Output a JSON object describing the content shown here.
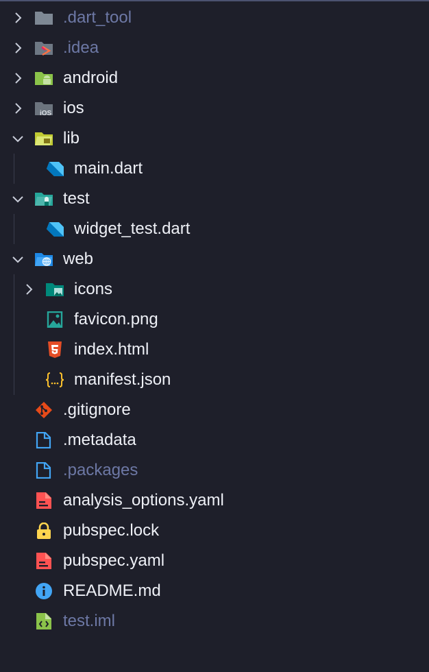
{
  "explorer": {
    "items": [
      {
        "label": ".dart_tool",
        "kind": "folder",
        "expanded": false,
        "dimmed": true,
        "icon": "folder-icon",
        "color": "#7e8894"
      },
      {
        "label": ".idea",
        "kind": "folder",
        "expanded": false,
        "dimmed": true,
        "icon": "idea-folder-icon",
        "color": "#7e8894"
      },
      {
        "label": "android",
        "kind": "folder",
        "expanded": false,
        "dimmed": false,
        "icon": "android-folder-icon",
        "color": "#8bc34a"
      },
      {
        "label": "ios",
        "kind": "folder",
        "expanded": false,
        "dimmed": false,
        "icon": "ios-folder-icon",
        "color": "#8a929c"
      },
      {
        "label": "lib",
        "kind": "folder",
        "expanded": true,
        "dimmed": false,
        "icon": "lib-folder-icon",
        "color": "#c0ca33"
      },
      {
        "label": "main.dart",
        "kind": "file",
        "dimmed": false,
        "icon": "dart-icon",
        "color": "#4fc3f7"
      },
      {
        "label": "test",
        "kind": "folder",
        "expanded": true,
        "dimmed": false,
        "icon": "test-folder-icon",
        "color": "#26a69a"
      },
      {
        "label": "widget_test.dart",
        "kind": "file",
        "dimmed": false,
        "icon": "dart-icon",
        "color": "#4fc3f7"
      },
      {
        "label": "web",
        "kind": "folder",
        "expanded": true,
        "dimmed": false,
        "icon": "web-folder-icon",
        "color": "#2196f3"
      },
      {
        "label": "icons",
        "kind": "folder",
        "expanded": false,
        "dimmed": false,
        "icon": "images-folder-icon",
        "color": "#009688"
      },
      {
        "label": "favicon.png",
        "kind": "file",
        "dimmed": false,
        "icon": "image-icon",
        "color": "#26a69a"
      },
      {
        "label": "index.html",
        "kind": "file",
        "dimmed": false,
        "icon": "html-icon",
        "color": "#e44d26"
      },
      {
        "label": "manifest.json",
        "kind": "file",
        "dimmed": false,
        "icon": "json-icon",
        "color": "#fbc02d"
      },
      {
        "label": ".gitignore",
        "kind": "file",
        "dimmed": false,
        "icon": "git-icon",
        "color": "#e64a19"
      },
      {
        "label": ".metadata",
        "kind": "file",
        "dimmed": false,
        "icon": "file-icon",
        "color": "#42a5f5"
      },
      {
        "label": ".packages",
        "kind": "file",
        "dimmed": true,
        "icon": "file-icon",
        "color": "#42a5f5"
      },
      {
        "label": "analysis_options.yaml",
        "kind": "file",
        "dimmed": false,
        "icon": "yaml-icon",
        "color": "#ff5252"
      },
      {
        "label": "pubspec.lock",
        "kind": "file",
        "dimmed": false,
        "icon": "lock-icon",
        "color": "#ffd54f"
      },
      {
        "label": "pubspec.yaml",
        "kind": "file",
        "dimmed": false,
        "icon": "yaml-icon",
        "color": "#ff5252"
      },
      {
        "label": "README.md",
        "kind": "file",
        "dimmed": false,
        "icon": "info-icon",
        "color": "#42a5f5"
      },
      {
        "label": "test.iml",
        "kind": "file",
        "dimmed": true,
        "icon": "iml-icon",
        "color": "#8bc34a"
      }
    ]
  }
}
